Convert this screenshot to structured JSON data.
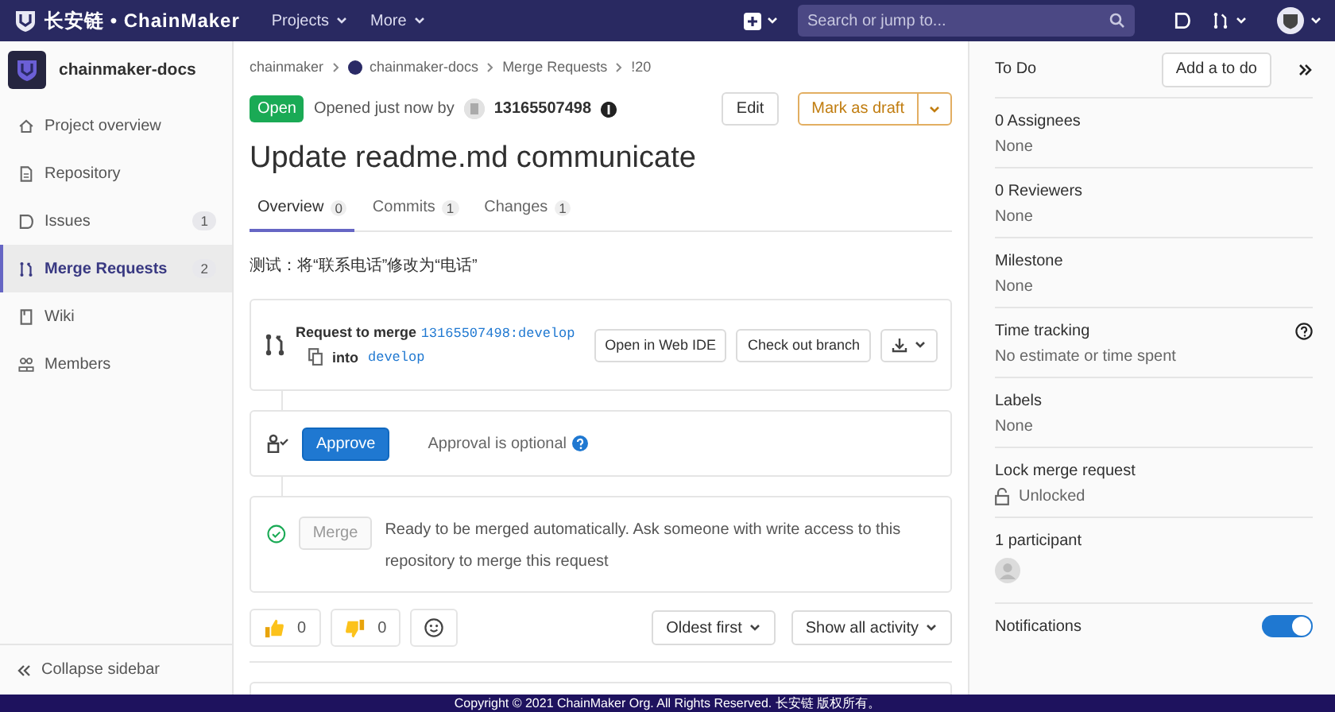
{
  "topbar": {
    "logo": "长安链 • ChainMaker",
    "menus": [
      {
        "label": "Projects"
      },
      {
        "label": "More"
      }
    ],
    "search": {
      "placeholder": "Search or jump to..."
    }
  },
  "sidebar": {
    "project": "chainmaker-docs",
    "items": [
      {
        "label": "Project overview",
        "selected": false
      },
      {
        "label": "Repository",
        "selected": false
      },
      {
        "label": "Issues",
        "count": "1",
        "selected": false
      },
      {
        "label": "Merge Requests",
        "count": "2",
        "selected": true
      },
      {
        "label": "Wiki",
        "selected": false
      },
      {
        "label": "Members",
        "selected": false
      }
    ],
    "collapse": "Collapse sidebar"
  },
  "breadcrumb": [
    "chainmaker",
    "chainmaker-docs",
    "Merge Requests",
    "!20"
  ],
  "header": {
    "status": "Open",
    "opened": "Opened just now by",
    "author": "13165507498",
    "edit": "Edit",
    "draft": "Mark as draft"
  },
  "title": "Update readme.md communicate",
  "tabs": [
    {
      "label": "Overview",
      "count": "0",
      "selected": true
    },
    {
      "label": "Commits",
      "count": "1",
      "selected": false
    },
    {
      "label": "Changes",
      "count": "1",
      "selected": false
    }
  ],
  "description": "测试：将“联系电话”修改为“电话”",
  "merge_request": {
    "request_label": "Request to merge",
    "source": "13165507498:develop",
    "into_label": "into",
    "target": "develop",
    "buttons": [
      "Open in Web IDE",
      "Check out branch"
    ]
  },
  "approval": {
    "button": "Approve",
    "note": "Approval is optional"
  },
  "merge": {
    "button": "Merge",
    "disabled": true,
    "message": "Ready to be merged automatically. Ask someone with write access to this repository to merge this request"
  },
  "reactions": [
    {
      "kind": "thumbsup",
      "count": "0"
    },
    {
      "kind": "thumbsdown",
      "count": "0"
    }
  ],
  "sort": [
    "Oldest first",
    "Show all activity"
  ],
  "right": {
    "todo_label": "To Do",
    "todo_button": "Add a to do",
    "sections": [
      {
        "kind": "text",
        "title": "0 Assignees",
        "value": "None"
      },
      {
        "kind": "text",
        "title": "0 Reviewers",
        "value": "None"
      },
      {
        "kind": "text",
        "title": "Milestone",
        "value": "None"
      },
      {
        "kind": "help",
        "title": "Time tracking",
        "value": "No estimate or time spent"
      },
      {
        "kind": "text",
        "title": "Labels",
        "value": "None"
      },
      {
        "kind": "lock",
        "title": "Lock merge request",
        "value": "Unlocked"
      },
      {
        "kind": "participants",
        "title": "1 participant"
      }
    ],
    "notifications": {
      "label": "Notifications",
      "on": true
    }
  },
  "footer": "Copyright © 2021 ChainMaker Org. All Rights Reserved. 长安链 版权所有。"
}
